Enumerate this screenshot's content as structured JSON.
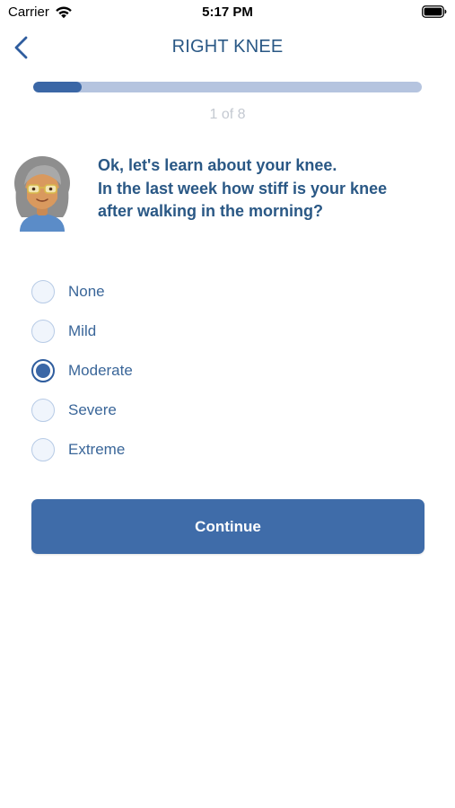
{
  "status_bar": {
    "carrier": "Carrier",
    "time": "5:17 PM"
  },
  "nav": {
    "title": "RIGHT KNEE",
    "back_icon": "chevron-left-icon"
  },
  "progress": {
    "label": "1 of 8",
    "current": 1,
    "total": 8,
    "fraction": 0.125
  },
  "question": {
    "avatar": "elderly-woman-avatar",
    "lines": [
      "Ok, let's learn about your knee.",
      "In the last week how stiff is your knee",
      "after walking in the morning?"
    ]
  },
  "options": [
    {
      "label": "None",
      "selected": false
    },
    {
      "label": "Mild",
      "selected": false
    },
    {
      "label": "Moderate",
      "selected": true
    },
    {
      "label": "Severe",
      "selected": false
    },
    {
      "label": "Extreme",
      "selected": false
    }
  ],
  "continue_label": "Continue",
  "colors": {
    "accent": "#3f6ca9",
    "title": "#2a5885",
    "progress_track": "#b5c4df",
    "progress_fill": "#3b67a6",
    "muted": "#c4c9d1"
  }
}
